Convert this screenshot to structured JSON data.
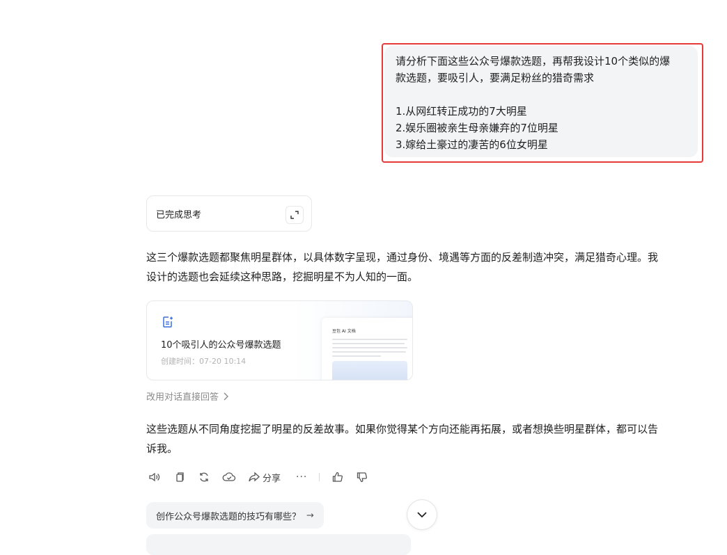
{
  "user_message": {
    "lines": [
      "请分析下面这些公众号爆款选题，再帮我设计10个类似的爆",
      "款选题，要吸引人，要满足粉丝的猎奇需求",
      "",
      "1.从网红转正成功的7大明星",
      "2.娱乐圈被亲生母亲嫌弃的7位明星",
      "3.嫁给土豪过的凄苦的6位女明星"
    ]
  },
  "thinking": {
    "label": "已完成思考",
    "expand_icon": "expand-icon"
  },
  "response": {
    "intro_lines": [
      "这三个爆款选题都聚焦明星群体，以具体数字呈现，通过身份、境遇等方面的反差制造冲突，满足猎奇心理。我",
      "设计的选题也会延续这种思路，挖掘明星不为人知的一面。"
    ],
    "doc_card": {
      "icon": "ai-doc-icon",
      "title": "10个吸引人的公众号爆款选题",
      "time": "创建时间：07-20 10:14",
      "preview_title": "豆包 AI 文档"
    },
    "switch_link": "改用对话直接回答",
    "closing_lines": [
      "这些选题从不同角度挖掘了明星的反差故事。如果你觉得某个方向还能再拓展，或者想换些明星群体，都可以告",
      "诉我。"
    ]
  },
  "actions": {
    "share_label": "分享",
    "more_label": "···"
  },
  "suggestions": [
    {
      "text": "创作公众号爆款选题的技巧有哪些？",
      "arrow": "→"
    }
  ]
}
